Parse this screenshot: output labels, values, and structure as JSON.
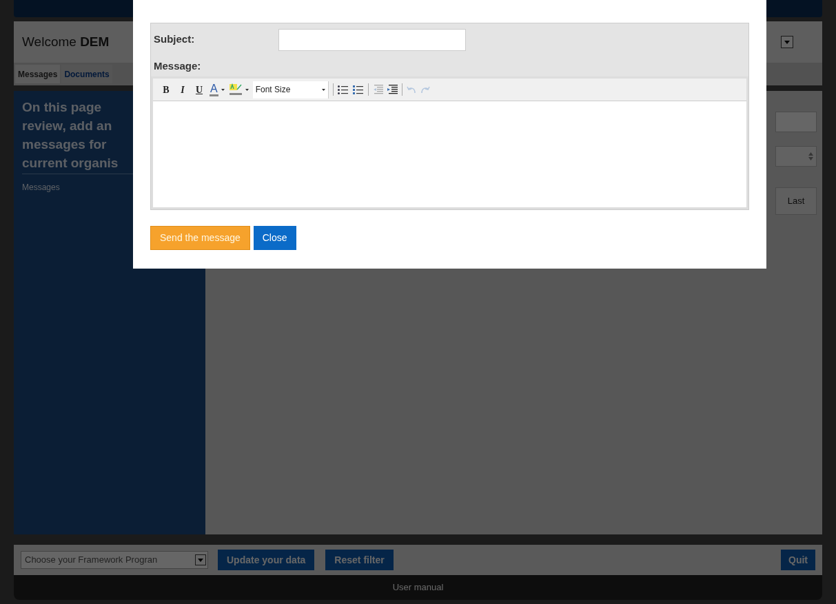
{
  "background": {
    "welcome": {
      "text": "Welcome",
      "name": "DEM"
    },
    "tabs": [
      {
        "label": "Messages",
        "selected": true
      },
      {
        "label": "Documents",
        "selected": false
      }
    ],
    "intro_lines": [
      "On this page",
      "review, add an",
      "messages for",
      "current organis"
    ],
    "sidebar_link": "Messages",
    "last_button": "Last",
    "program_select": "Choose your Framework Progran",
    "buttons": [
      "Update your data",
      "Reset filter"
    ],
    "quit_button": "Quit",
    "footer_link": "User manual"
  },
  "dialog": {
    "subject_label": "Subject:",
    "message_label": "Message:",
    "toolbar": [
      {
        "kind": "bold",
        "label": "B",
        "disabled": false
      },
      {
        "kind": "italic",
        "label": "I",
        "disabled": false
      },
      {
        "kind": "underline",
        "label": "U",
        "disabled": false
      },
      {
        "kind": "font-color",
        "label": "A",
        "disabled": false
      },
      {
        "kind": "highlight",
        "disabled": false
      },
      {
        "kind": "font-size",
        "label": "Font Size",
        "disabled": false
      },
      {
        "kind": "separator"
      },
      {
        "kind": "bullet-list",
        "disabled": false
      },
      {
        "kind": "numbered-list",
        "disabled": false
      },
      {
        "kind": "separator"
      },
      {
        "kind": "outdent",
        "disabled": true
      },
      {
        "kind": "indent",
        "disabled": false
      },
      {
        "kind": "separator"
      },
      {
        "kind": "undo",
        "disabled": true
      },
      {
        "kind": "redo",
        "disabled": true
      }
    ],
    "send_button": "Send the message",
    "close_button": "Close"
  }
}
